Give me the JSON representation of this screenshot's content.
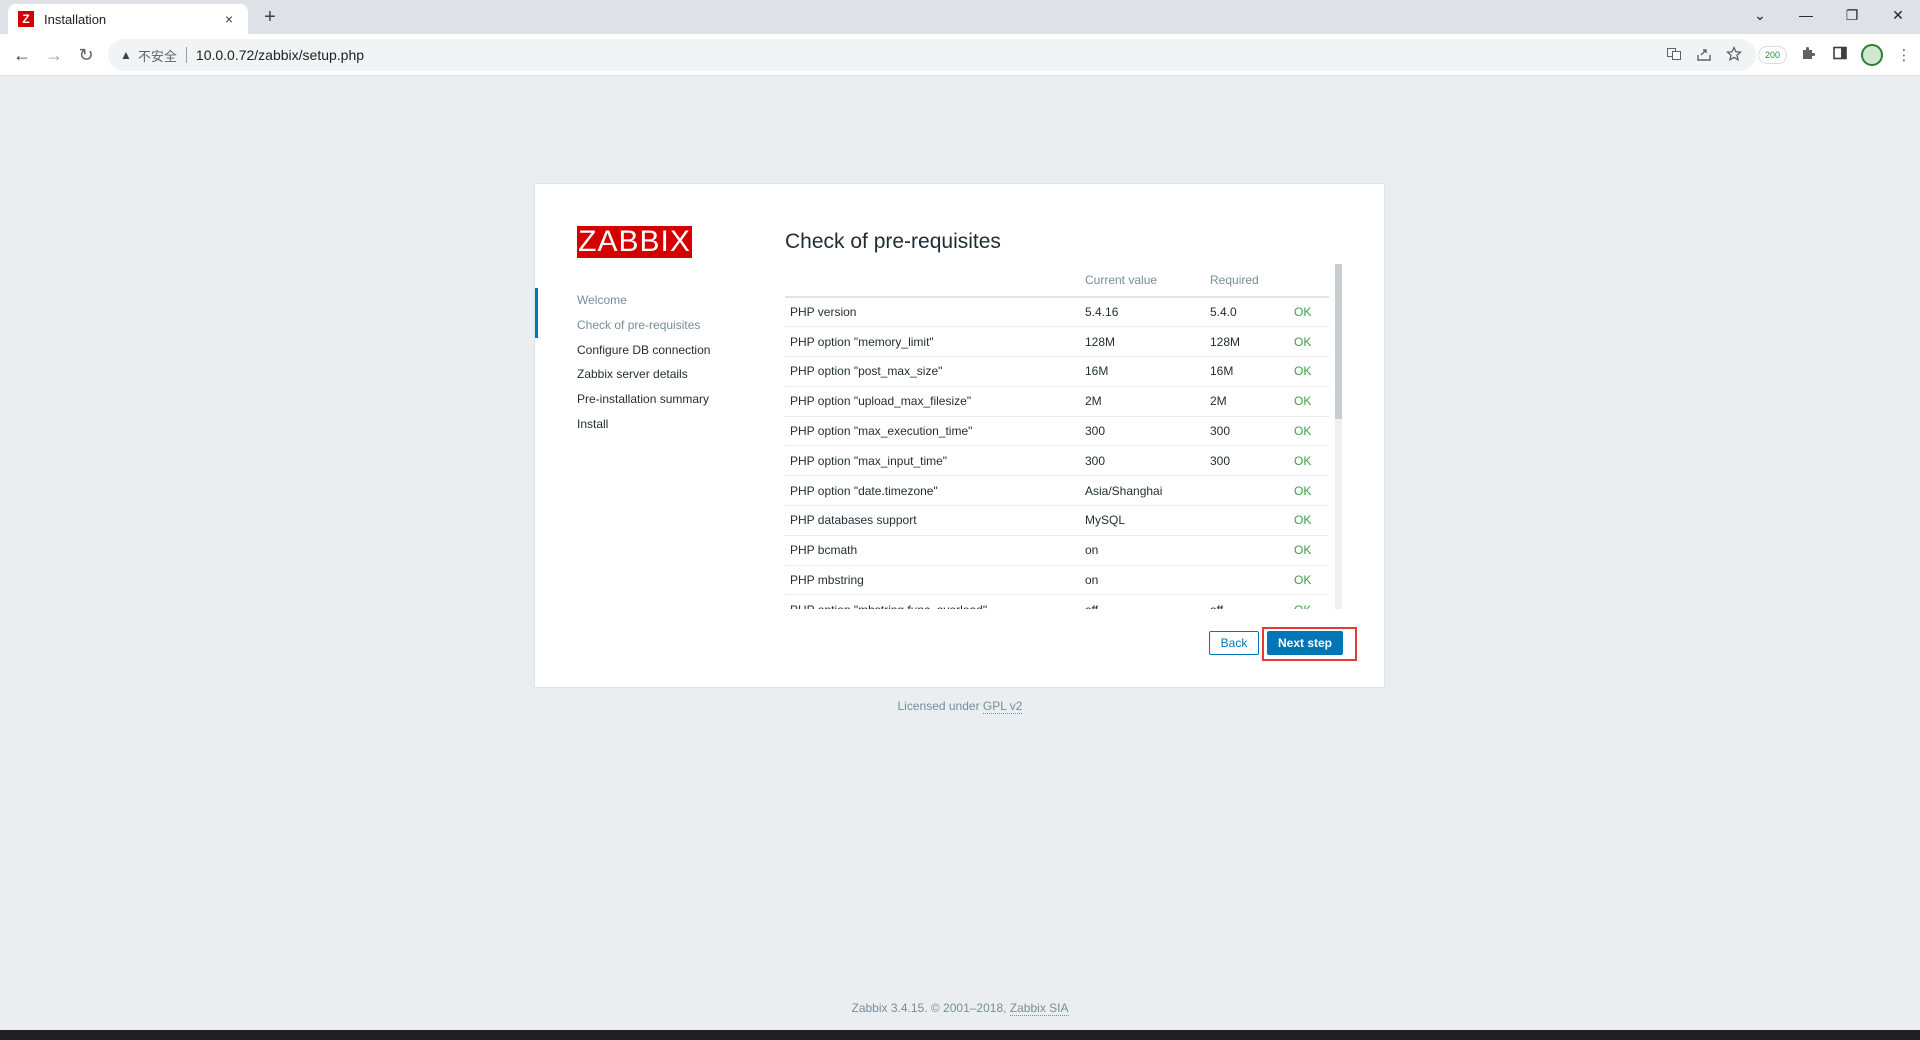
{
  "browser": {
    "tab_title": "Installation",
    "tab_close": "×",
    "new_tab": "+",
    "window_controls": {
      "dropdown": "⌄",
      "minimize": "—",
      "restore": "❐",
      "close": "✕"
    },
    "nav": {
      "back": "←",
      "forward": "→",
      "reload": "↻"
    },
    "security_warning_icon": "▲",
    "security_label": "不安全",
    "url": "10.0.0.72/zabbix/setup.php",
    "omnibox_icons": [
      "translate-icon",
      "share-icon",
      "star-icon"
    ],
    "extension_badge": "200",
    "extension_icons": [
      "puzzle-icon",
      "sidebar-icon",
      "avatar"
    ],
    "menu": "⋮"
  },
  "setup": {
    "logo_text": "ZABBIX",
    "steps": [
      {
        "label": "Welcome",
        "state": "done"
      },
      {
        "label": "Check of pre-requisites",
        "state": "current"
      },
      {
        "label": "Configure DB connection",
        "state": "todo"
      },
      {
        "label": "Zabbix server details",
        "state": "todo"
      },
      {
        "label": "Pre-installation summary",
        "state": "todo"
      },
      {
        "label": "Install",
        "state": "todo"
      }
    ],
    "title": "Check of pre-requisites",
    "table": {
      "headers": [
        "",
        "Current value",
        "Required",
        ""
      ],
      "rows": [
        [
          "PHP version",
          "5.4.16",
          "5.4.0",
          "OK"
        ],
        [
          "PHP option \"memory_limit\"",
          "128M",
          "128M",
          "OK"
        ],
        [
          "PHP option \"post_max_size\"",
          "16M",
          "16M",
          "OK"
        ],
        [
          "PHP option \"upload_max_filesize\"",
          "2M",
          "2M",
          "OK"
        ],
        [
          "PHP option \"max_execution_time\"",
          "300",
          "300",
          "OK"
        ],
        [
          "PHP option \"max_input_time\"",
          "300",
          "300",
          "OK"
        ],
        [
          "PHP option \"date.timezone\"",
          "Asia/Shanghai",
          "",
          "OK"
        ],
        [
          "PHP databases support",
          "MySQL",
          "",
          "OK"
        ],
        [
          "PHP bcmath",
          "on",
          "",
          "OK"
        ],
        [
          "PHP mbstring",
          "on",
          "",
          "OK"
        ],
        [
          "PHP option \"mbstring.func_overload\"",
          "off",
          "off",
          "OK"
        ]
      ]
    },
    "back_button": "Back",
    "next_button": "Next step"
  },
  "license": {
    "prefix": "Licensed under ",
    "link": "GPL v2"
  },
  "footer": {
    "text": "Zabbix 3.4.15. © 2001–2018, ",
    "link": "Zabbix SIA"
  },
  "colors": {
    "accent": "#0275b8",
    "brand": "#d40000",
    "ok": "#429e47",
    "highlight": "#e53935"
  }
}
